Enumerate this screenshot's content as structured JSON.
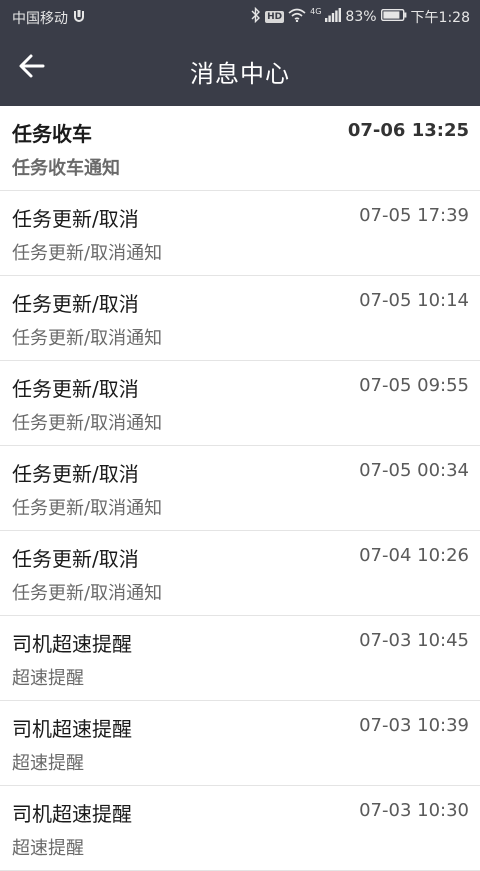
{
  "status_bar": {
    "carrier": "中国移动",
    "hd_badge": "HD",
    "network_tag": "4G",
    "battery_percent": "83%",
    "time": "下午1:28",
    "icons": [
      "usb-icon",
      "bluetooth-icon",
      "hd-icon",
      "wifi-icon",
      "signal-icon",
      "battery-icon"
    ]
  },
  "header": {
    "title": "消息中心",
    "back_icon": "arrow-left-icon"
  },
  "colors": {
    "header_bg": "#3a3d48",
    "list_bg": "#ffffff",
    "divider": "#e4e4e4",
    "title_text": "#1a1a1a",
    "subtitle_text": "#6a6a6a"
  },
  "messages": [
    {
      "title": "任务收车",
      "subtitle": "任务收车通知",
      "time": "07-06 13:25",
      "unread": true
    },
    {
      "title": "任务更新/取消",
      "subtitle": "任务更新/取消通知",
      "time": "07-05 17:39",
      "unread": false
    },
    {
      "title": "任务更新/取消",
      "subtitle": "任务更新/取消通知",
      "time": "07-05 10:14",
      "unread": false
    },
    {
      "title": "任务更新/取消",
      "subtitle": "任务更新/取消通知",
      "time": "07-05 09:55",
      "unread": false
    },
    {
      "title": "任务更新/取消",
      "subtitle": "任务更新/取消通知",
      "time": "07-05 00:34",
      "unread": false
    },
    {
      "title": "任务更新/取消",
      "subtitle": "任务更新/取消通知",
      "time": "07-04 10:26",
      "unread": false
    },
    {
      "title": "司机超速提醒",
      "subtitle": "超速提醒",
      "time": "07-03 10:45",
      "unread": false
    },
    {
      "title": "司机超速提醒",
      "subtitle": "超速提醒",
      "time": "07-03 10:39",
      "unread": false
    },
    {
      "title": "司机超速提醒",
      "subtitle": "超速提醒",
      "time": "07-03 10:30",
      "unread": false
    }
  ]
}
